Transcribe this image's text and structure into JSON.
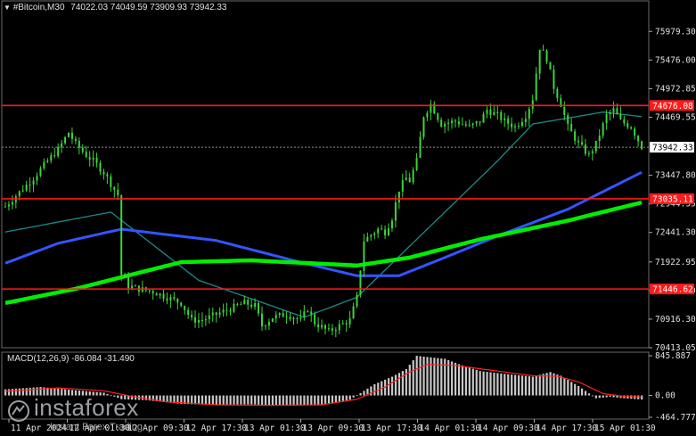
{
  "header": {
    "symbol": "#Bitcoin,M30",
    "ohlc": "74022.03 74049.59 73909.93 73942.33"
  },
  "macd": {
    "label": "MACD(12,26,9) -86.084 -31.490"
  },
  "watermark": {
    "name": "instaforex",
    "sub": "Instant Forex Trading"
  },
  "colors": {
    "background": "#000000",
    "candle": "#3cd43c",
    "ma_slow": "#00ee00",
    "ma_mid": "#3355ff",
    "ma_fast": "#1a8a8a",
    "level_line": "#ff1a1a",
    "bid_line": "#8a8f99",
    "macd_hist": "#c8c8c8",
    "macd_signal": "#ff2020"
  },
  "chart_data": {
    "type": "candlestick",
    "timeframe": "M30",
    "ylim": [
      70413,
      76250
    ],
    "price_ticks": [
      "75979.30",
      "75476.00",
      "74972.85",
      "74469.55",
      "73447.80",
      "72944.55",
      "72441.30",
      "71922.95",
      "71419.60",
      "70916.30",
      "70413.05"
    ],
    "bid_price": "73942.33",
    "levels": [
      {
        "value": 74676.08,
        "label": "74676.08"
      },
      {
        "value": 73035.11,
        "label": "73035.11"
      },
      {
        "value": 71446.62,
        "label": "71446.62"
      }
    ],
    "time_ticks": [
      "11 Apr 2024",
      "12 Apr 01:30",
      "12 Apr 09:30",
      "12 Apr 17:30",
      "13 Apr 01:30",
      "13 Apr 09:30",
      "13 Apr 17:30",
      "14 Apr 01:30",
      "14 Apr 09:30",
      "14 Apr 17:30",
      "15 Apr 01:30"
    ],
    "price_anchors": [
      [
        0,
        72900
      ],
      [
        4,
        73150
      ],
      [
        8,
        73400
      ],
      [
        12,
        73700
      ],
      [
        15,
        73900
      ],
      [
        18,
        74200
      ],
      [
        20,
        74000
      ],
      [
        23,
        73800
      ],
      [
        25,
        73700
      ],
      [
        28,
        73500
      ],
      [
        30,
        73300
      ],
      [
        32,
        73100
      ],
      [
        33,
        71700
      ],
      [
        35,
        71500
      ],
      [
        38,
        71450
      ],
      [
        42,
        71400
      ],
      [
        46,
        71300
      ],
      [
        50,
        71200
      ],
      [
        53,
        70900
      ],
      [
        56,
        70900
      ],
      [
        60,
        71000
      ],
      [
        64,
        71100
      ],
      [
        68,
        71200
      ],
      [
        71,
        71150
      ],
      [
        73,
        70800
      ],
      [
        76,
        70950
      ],
      [
        80,
        71000
      ],
      [
        84,
        70900
      ],
      [
        86,
        71100
      ],
      [
        88,
        70850
      ],
      [
        92,
        70700
      ],
      [
        95,
        70800
      ],
      [
        98,
        70900
      ],
      [
        100,
        71300
      ],
      [
        102,
        72300
      ],
      [
        104,
        72400
      ],
      [
        106,
        72500
      ],
      [
        108,
        72450
      ],
      [
        110,
        72700
      ],
      [
        112,
        73200
      ],
      [
        114,
        73400
      ],
      [
        115,
        73350
      ],
      [
        117,
        73700
      ],
      [
        119,
        74500
      ],
      [
        121,
        74700
      ],
      [
        124,
        74350
      ],
      [
        128,
        74400
      ],
      [
        132,
        74300
      ],
      [
        135,
        74400
      ],
      [
        137,
        74600
      ],
      [
        140,
        74500
      ],
      [
        142,
        74400
      ],
      [
        145,
        74300
      ],
      [
        148,
        74500
      ],
      [
        150,
        74800
      ],
      [
        152,
        75700
      ],
      [
        154,
        75500
      ],
      [
        156,
        75000
      ],
      [
        158,
        74700
      ],
      [
        160,
        74300
      ],
      [
        163,
        74000
      ],
      [
        166,
        73800
      ],
      [
        168,
        74000
      ],
      [
        171,
        74500
      ],
      [
        173,
        74600
      ],
      [
        175,
        74400
      ],
      [
        178,
        74300
      ],
      [
        181,
        73950
      ]
    ],
    "ma_fast": [
      [
        0,
        72450
      ],
      [
        30,
        72800
      ],
      [
        55,
        71600
      ],
      [
        85,
        70950
      ],
      [
        100,
        71300
      ],
      [
        120,
        72500
      ],
      [
        140,
        73700
      ],
      [
        150,
        74350
      ],
      [
        170,
        74560
      ],
      [
        181,
        74480
      ]
    ],
    "ma_mid": [
      [
        0,
        71900
      ],
      [
        15,
        72250
      ],
      [
        33,
        72500
      ],
      [
        60,
        72300
      ],
      [
        85,
        71900
      ],
      [
        100,
        71680
      ],
      [
        112,
        71680
      ],
      [
        125,
        72000
      ],
      [
        140,
        72380
      ],
      [
        160,
        72850
      ],
      [
        181,
        73500
      ]
    ],
    "ma_slow": [
      [
        0,
        71200
      ],
      [
        20,
        71450
      ],
      [
        50,
        71920
      ],
      [
        70,
        71950
      ],
      [
        100,
        71860
      ],
      [
        115,
        72000
      ],
      [
        135,
        72320
      ],
      [
        160,
        72650
      ],
      [
        181,
        72970
      ]
    ],
    "macd": {
      "ylim": [
        -464.777,
        845.887
      ],
      "ticks": [
        "845.887",
        "0.00",
        "-464.777"
      ],
      "hist_anchors": [
        [
          0,
          130
        ],
        [
          10,
          180
        ],
        [
          20,
          110
        ],
        [
          28,
          60
        ],
        [
          33,
          -80
        ],
        [
          40,
          -100
        ],
        [
          50,
          -180
        ],
        [
          60,
          -200
        ],
        [
          70,
          -190
        ],
        [
          80,
          -220
        ],
        [
          90,
          -200
        ],
        [
          98,
          -90
        ],
        [
          105,
          240
        ],
        [
          110,
          400
        ],
        [
          114,
          560
        ],
        [
          117,
          845
        ],
        [
          120,
          820
        ],
        [
          125,
          780
        ],
        [
          130,
          640
        ],
        [
          135,
          520
        ],
        [
          142,
          460
        ],
        [
          150,
          400
        ],
        [
          155,
          500
        ],
        [
          158,
          420
        ],
        [
          163,
          200
        ],
        [
          168,
          -60
        ],
        [
          172,
          -30
        ],
        [
          176,
          -60
        ],
        [
          181,
          -86
        ]
      ],
      "signal_anchors": [
        [
          0,
          90
        ],
        [
          15,
          160
        ],
        [
          28,
          100
        ],
        [
          36,
          -20
        ],
        [
          45,
          -130
        ],
        [
          60,
          -200
        ],
        [
          75,
          -210
        ],
        [
          90,
          -200
        ],
        [
          100,
          -80
        ],
        [
          108,
          180
        ],
        [
          115,
          500
        ],
        [
          120,
          660
        ],
        [
          128,
          640
        ],
        [
          140,
          520
        ],
        [
          150,
          420
        ],
        [
          157,
          410
        ],
        [
          163,
          290
        ],
        [
          170,
          40
        ],
        [
          176,
          -20
        ],
        [
          181,
          -31
        ]
      ]
    }
  }
}
